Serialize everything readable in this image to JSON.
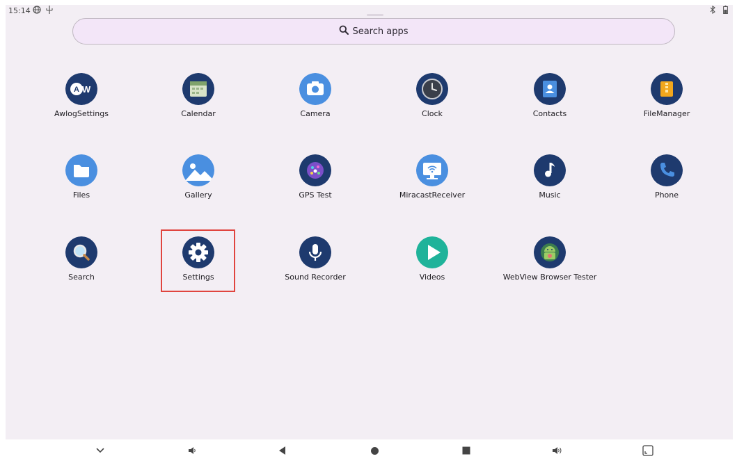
{
  "status_bar": {
    "time": "15:14",
    "left_icons": [
      "vpn-globe-icon",
      "usb-icon"
    ],
    "right_icons": [
      "bluetooth-icon",
      "battery-icon"
    ]
  },
  "search": {
    "label": "Search apps",
    "icon": "search-icon"
  },
  "apps": [
    {
      "label": "AwlogSettings",
      "icon": "awlog-settings-icon"
    },
    {
      "label": "Calendar",
      "icon": "calendar-icon"
    },
    {
      "label": "Camera",
      "icon": "camera-icon"
    },
    {
      "label": "Clock",
      "icon": "clock-icon"
    },
    {
      "label": "Contacts",
      "icon": "contacts-icon"
    },
    {
      "label": "FileManager",
      "icon": "file-manager-icon"
    },
    {
      "label": "Files",
      "icon": "files-icon"
    },
    {
      "label": "Gallery",
      "icon": "gallery-icon"
    },
    {
      "label": "GPS Test",
      "icon": "gps-test-icon"
    },
    {
      "label": "MiracastReceiver",
      "icon": "miracast-receiver-icon"
    },
    {
      "label": "Music",
      "icon": "music-icon"
    },
    {
      "label": "Phone",
      "icon": "phone-icon"
    },
    {
      "label": "Search",
      "icon": "search-app-icon"
    },
    {
      "label": "Settings",
      "icon": "settings-gear-icon",
      "highlighted": true
    },
    {
      "label": "Sound Recorder",
      "icon": "sound-recorder-icon"
    },
    {
      "label": "Videos",
      "icon": "videos-icon"
    },
    {
      "label": "WebView Browser Tester",
      "icon": "webview-browser-tester-icon"
    }
  ],
  "nav_bar": {
    "buttons": [
      "collapse-chevron-icon",
      "volume-down-icon",
      "back-icon",
      "home-icon",
      "recents-icon",
      "volume-up-icon",
      "screenshot-icon"
    ]
  },
  "colors": {
    "background": "#f3eef4",
    "search_bar": "#f3e6f8",
    "icon_circle": "#1e3a6e",
    "highlight": "#e0443e"
  }
}
